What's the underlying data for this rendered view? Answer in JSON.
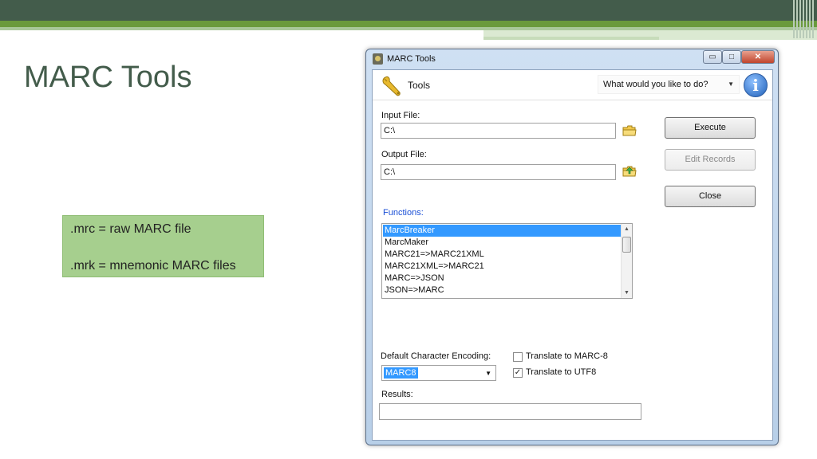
{
  "slide": {
    "title": "MARC Tools",
    "notes": [
      ".mrc = raw MARC file",
      ".mrk = mnemonic MARC files"
    ]
  },
  "window": {
    "title": "MARC Tools",
    "controls": {
      "minimize": "▭",
      "maximize": "□",
      "close": "✕"
    }
  },
  "toolbar": {
    "tools_label": "Tools",
    "action_select": "What would you like to do?"
  },
  "form": {
    "input_file_label": "Input File:",
    "input_file_value": "C:\\",
    "output_file_label": "Output File:",
    "output_file_value": "C:\\",
    "functions_label": "Functions:",
    "functions": [
      "MarcBreaker",
      "MarcMaker",
      "MARC21=>MARC21XML",
      "MARC21XML=>MARC21",
      "MARC=>JSON",
      "JSON=>MARC"
    ],
    "selected_function": "MarcBreaker",
    "encoding_label": "Default Character Encoding:",
    "encoding_value": "MARC8",
    "translate_marc8_label": "Translate to MARC-8",
    "translate_marc8_checked": false,
    "translate_utf8_label": "Translate to UTF8",
    "translate_utf8_checked": true,
    "results_label": "Results:",
    "results_value": ""
  },
  "buttons": {
    "execute": "Execute",
    "edit_records": "Edit Records",
    "close": "Close"
  },
  "icons": {
    "app": "marc-tools-app-icon",
    "tools": "wrench-icon",
    "info": "info-icon",
    "browse_input": "folder-open-icon",
    "browse_output": "folder-save-icon"
  },
  "colors": {
    "slide_header": "#435c4b",
    "slide_accent": "#6a9a3c",
    "note_box": "#a6cf8e",
    "selection": "#3399ff",
    "functions_label": "#1a4fd6"
  }
}
